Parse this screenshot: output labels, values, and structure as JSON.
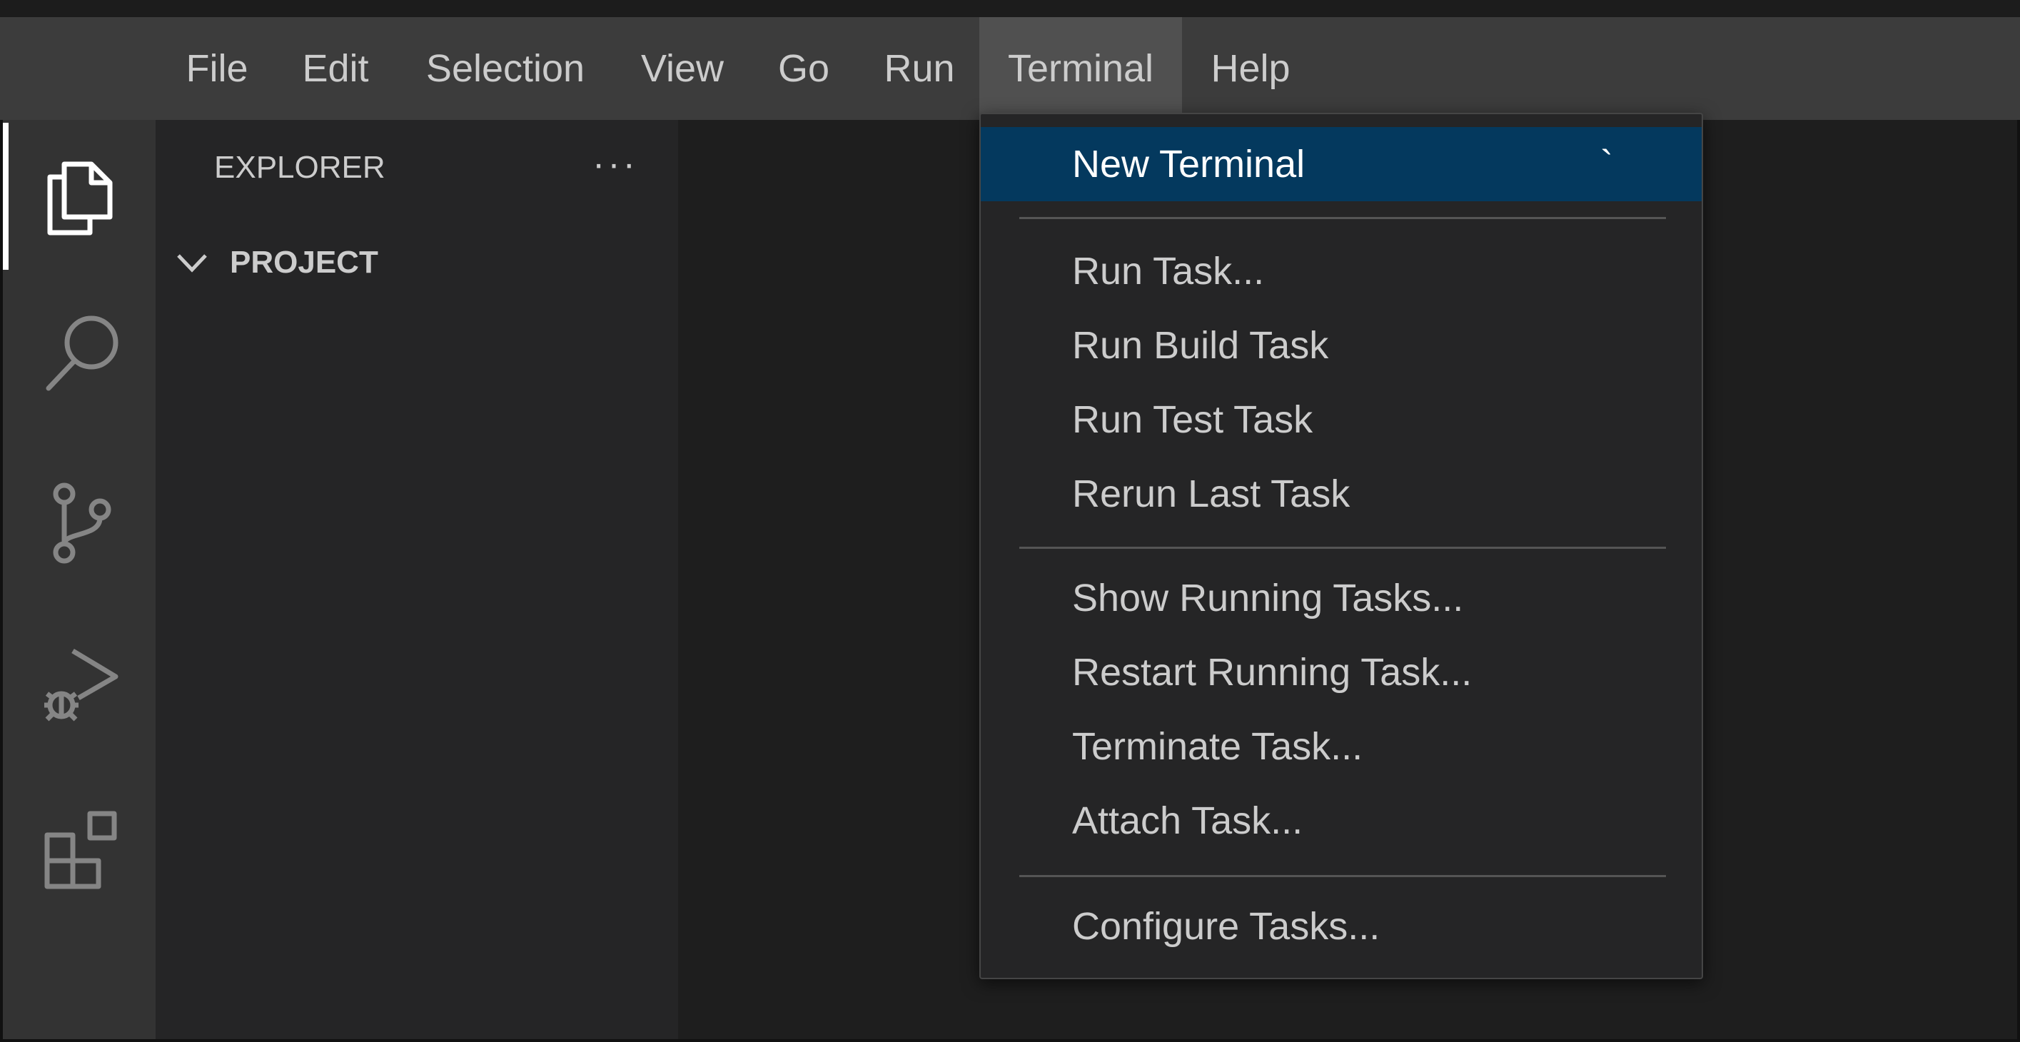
{
  "menubar": {
    "items": [
      "File",
      "Edit",
      "Selection",
      "View",
      "Go",
      "Run",
      "Terminal",
      "Help"
    ],
    "active": "Terminal"
  },
  "activitybar": {
    "icons": [
      "files-icon",
      "search-icon",
      "source-control-icon",
      "run-debug-icon",
      "extensions-icon"
    ],
    "active": "files-icon"
  },
  "sidebar": {
    "title": "EXPLORER",
    "more": "···",
    "project": "PROJECT"
  },
  "terminal_menu": {
    "groups": [
      [
        {
          "label": "New Terminal",
          "shortcut": "`",
          "highlighted": true
        }
      ],
      [
        {
          "label": "Run Task..."
        },
        {
          "label": "Run Build Task"
        },
        {
          "label": "Run Test Task"
        },
        {
          "label": "Rerun Last Task"
        }
      ],
      [
        {
          "label": "Show Running Tasks..."
        },
        {
          "label": "Restart Running Task..."
        },
        {
          "label": "Terminate Task..."
        },
        {
          "label": "Attach Task..."
        }
      ],
      [
        {
          "label": "Configure Tasks..."
        }
      ]
    ]
  },
  "colors": {
    "menubar_bg": "#3c3c3c",
    "activitybar_bg": "#333333",
    "sidebar_bg": "#252526",
    "editor_bg": "#1e1e1e",
    "highlight": "#04395e",
    "text": "#cccccc"
  }
}
